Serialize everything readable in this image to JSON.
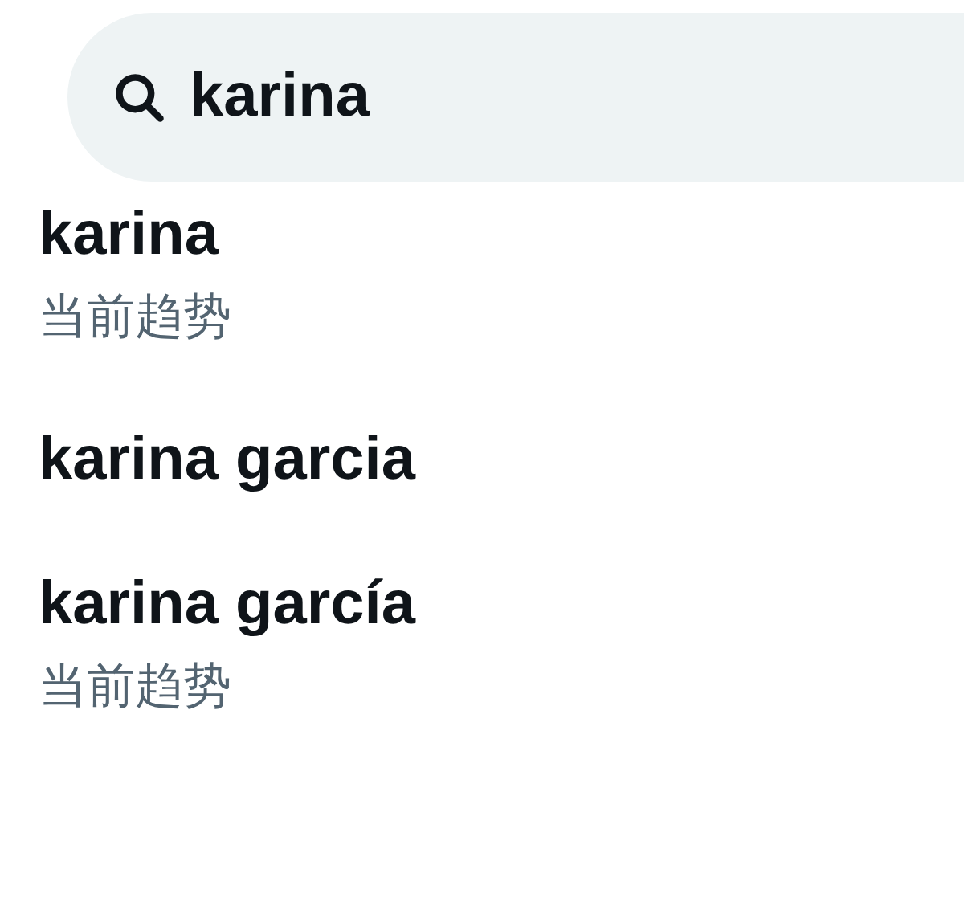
{
  "search": {
    "value": "karina"
  },
  "suggestions": [
    {
      "title": "karina",
      "subtitle": "当前趋势"
    },
    {
      "title": "karina garcia"
    },
    {
      "title": "karina garcía",
      "subtitle": "当前趋势"
    }
  ]
}
